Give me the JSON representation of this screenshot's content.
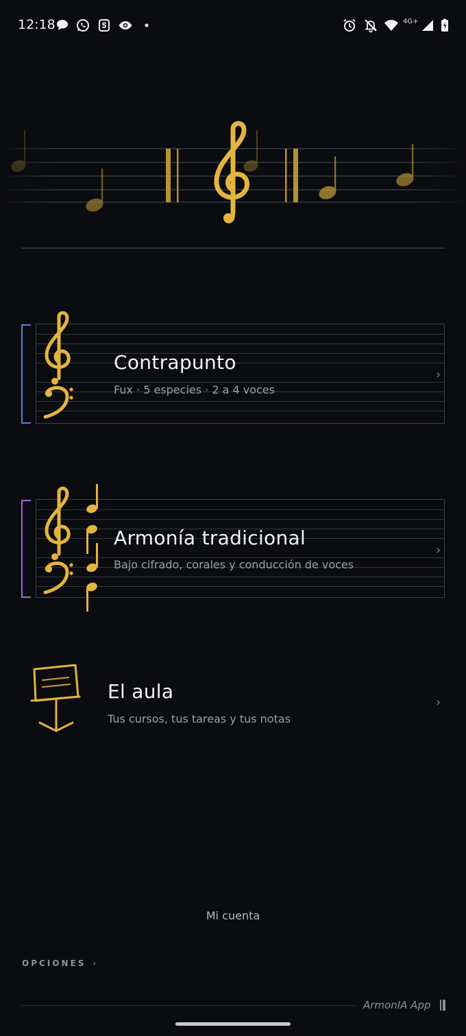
{
  "status_bar": {
    "time": "12:18",
    "network": "4G+",
    "left_icons": [
      "chat-bubble-icon",
      "whatsapp-icon",
      "s-app-icon",
      "eye-icon",
      "dot-icon"
    ],
    "right_icons": [
      "alarm-icon",
      "bell-off-icon",
      "wifi-icon",
      "signal-icon",
      "battery-icon"
    ]
  },
  "hero": {
    "icon": "treble-clef-icon",
    "accent_color": "#e3b43f"
  },
  "menu": [
    {
      "title": "Contrapunto",
      "subtitle": "Fux · 5 especies · 2 a 4 voces",
      "icon": "grand-staff-clefs-icon",
      "bracket_color": "#5b7fd6"
    },
    {
      "title": "Armonía tradicional",
      "subtitle": "Bajo cifrado, corales y conducción de voces",
      "icon": "clefs-with-notes-icon",
      "bracket_color": "#9b6ad0"
    },
    {
      "title": "El aula",
      "subtitle": "Tus cursos, tus tareas y tus notas",
      "icon": "music-stand-icon"
    }
  ],
  "footer": {
    "account_label": "Mi cuenta",
    "options_label": "OPCIONES",
    "options_chevron": "›",
    "brand": "ArmonIA App"
  },
  "chevron": "›"
}
